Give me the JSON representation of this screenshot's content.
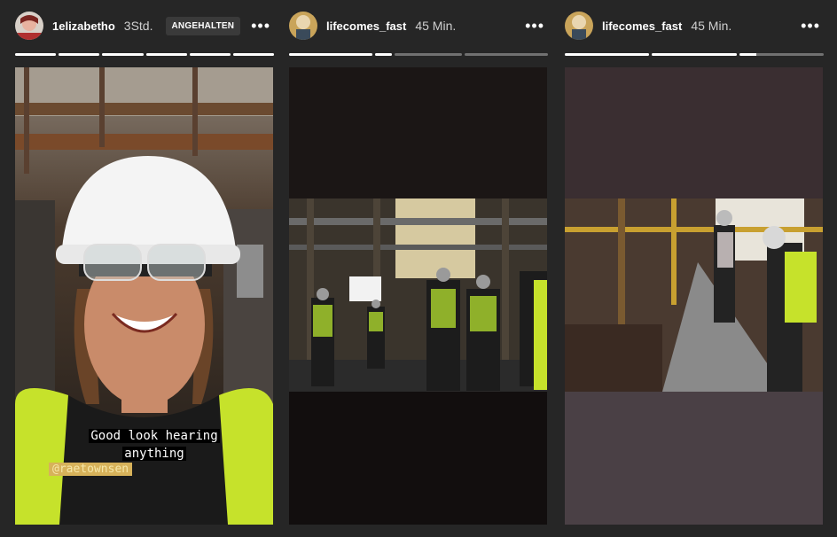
{
  "stories": [
    {
      "username": "1elizabetho",
      "time": "3Std.",
      "badge": "ANGEHALTEN",
      "avatar_icon": "user-avatar-icon",
      "progress": [
        1,
        1,
        1,
        1,
        1,
        1
      ],
      "caption_line1": "Good look hearing",
      "caption_line2": "anything",
      "mention": "@raetownsen"
    },
    {
      "username": "lifecomes_fast",
      "time": "45 Min.",
      "avatar_icon": "user-avatar-icon",
      "progress": [
        1,
        0.15,
        0,
        0
      ]
    },
    {
      "username": "lifecomes_fast",
      "time": "45 Min.",
      "avatar_icon": "user-avatar-icon",
      "progress": [
        1,
        1,
        0.2
      ]
    }
  ],
  "more_icon": "more-options-icon",
  "more_label": "•••",
  "colors": {
    "background": "#262626",
    "vest": "#c6e22b"
  }
}
